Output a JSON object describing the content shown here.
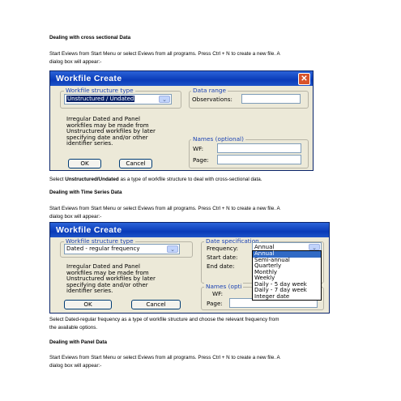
{
  "section1": {
    "heading": "Dealing with cross sectional Data",
    "para_line1": "Start Eviews from Start Menu or select Eviews from all programs. Press Ctrl + N to create a new file. A",
    "para_line2": "dialog box will appear:-"
  },
  "dialog1": {
    "title": "Workfile Create",
    "structure_legend": "Workfile structure type",
    "structure_value": "Unstructured / Undated",
    "range_legend": "Data range",
    "observations_label": "Observations:",
    "note": [
      "Irregular Dated and Panel",
      "workfiles may be made from",
      "Unstructured workfiles by later",
      "specifying date and/or other",
      "identifier series."
    ],
    "names_legend": "Names (optional)",
    "wf_label": "WF:",
    "page_label": "Page:",
    "ok_label": "OK",
    "cancel_label": "Cancel"
  },
  "caption1": {
    "prefix": "Select ",
    "bold": "Unstructured/Undated",
    "suffix": " as a type of workfile structure to deal with cross-sectional data."
  },
  "section2": {
    "heading": "Dealing with Time Series Data",
    "para_line1": "Start Eviews from Start Menu or select Eviews from all programs. Press Ctrl + N to create a new file. A",
    "para_line2": "dialog box will appear:-"
  },
  "dialog2": {
    "title": "Workfile Create",
    "structure_legend": "Workfile structure type",
    "structure_value": "Dated - regular frequency",
    "spec_legend": "Date specification",
    "frequency_label": "Frequency:",
    "frequency_value": "Annual",
    "start_label": "Start date:",
    "end_label": "End date:",
    "frequency_options": [
      "Annual",
      "Semi-annual",
      "Quarterly",
      "Monthly",
      "Weekly",
      "Daily - 5 day week",
      "Daily - 7 day week",
      "Integer date"
    ],
    "note": [
      "Irregular Dated and Panel",
      "workfiles may be made from",
      "Unstructured workfiles by later",
      "specifying date and/or other",
      "identifier series."
    ],
    "names_legend": "Names (opti",
    "wf_label": "WF:",
    "page_label": "Page:",
    "ok_label": "OK",
    "cancel_label": "Cancel"
  },
  "caption2": {
    "line1": "Select Dated-regular frequency as  a type of workfile structure and choose the relevant frequency from",
    "line2": "the available options."
  },
  "section3": {
    "heading": "Dealing with Panel Data",
    "para_line1": "Start Eviews from Start Menu or select Eviews from all programs. Press Ctrl + N to create a new file. A",
    "para_line2": "dialog box will appear:-"
  },
  "colors": {
    "titlebar": "#0a3bb8",
    "dialog_bg": "#ece9d8",
    "legend_text": "#1c43b4",
    "close_button": "#d9532a",
    "list_highlight": "#316ac5"
  },
  "icons": [
    "close-icon",
    "dropdown-arrow-icon"
  ]
}
